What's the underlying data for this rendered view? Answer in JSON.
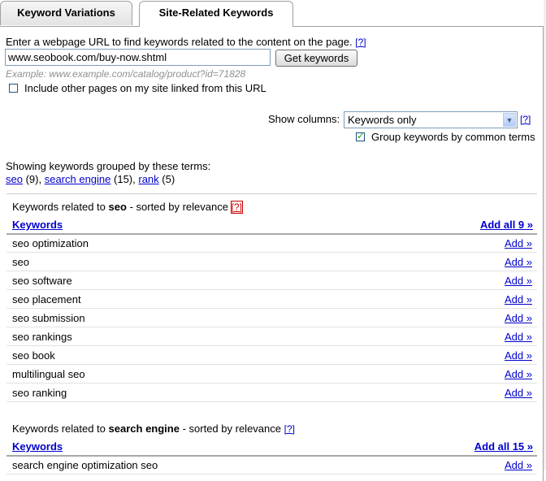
{
  "tabs": {
    "keyword_variations": "Keyword Variations",
    "site_related": "Site-Related Keywords"
  },
  "url_section": {
    "instruction": "Enter a webpage URL to find keywords related to the content on the page.",
    "help": "[?]",
    "url_value": "www.seobook.com/buy-now.shtml",
    "button": "Get keywords",
    "example": "Example: www.example.com/catalog/product?id=71828",
    "include_label": "Include other pages on my site linked from this URL",
    "include_checked": false
  },
  "columns": {
    "label": "Show columns:",
    "selected": "Keywords only",
    "help": "[?]",
    "group_label": "Group keywords by common terms",
    "group_checked": true
  },
  "grouping": {
    "intro": "Showing keywords grouped by these terms:",
    "terms": [
      {
        "term": "seo",
        "count": "(9),"
      },
      {
        "term": "search engine",
        "count": "(15),"
      },
      {
        "term": "rank",
        "count": "(5)"
      }
    ]
  },
  "groups": [
    {
      "prefix": "Keywords related to",
      "term": "seo",
      "suffix": "- sorted by relevance",
      "help": "[?]",
      "col_header": "Keywords",
      "add_all": "Add all 9 »",
      "add_label": "Add »",
      "keywords": [
        "seo optimization",
        "seo",
        "seo software",
        "seo placement",
        "seo submission",
        "seo rankings",
        "seo book",
        "multilingual seo",
        "seo ranking"
      ]
    },
    {
      "prefix": "Keywords related to",
      "term": "search engine",
      "suffix": "- sorted by relevance",
      "help": "[?]",
      "col_header": "Keywords",
      "add_all": "Add all 15 »",
      "add_label": "Add »",
      "keywords": [
        "search engine optimization seo"
      ]
    }
  ]
}
